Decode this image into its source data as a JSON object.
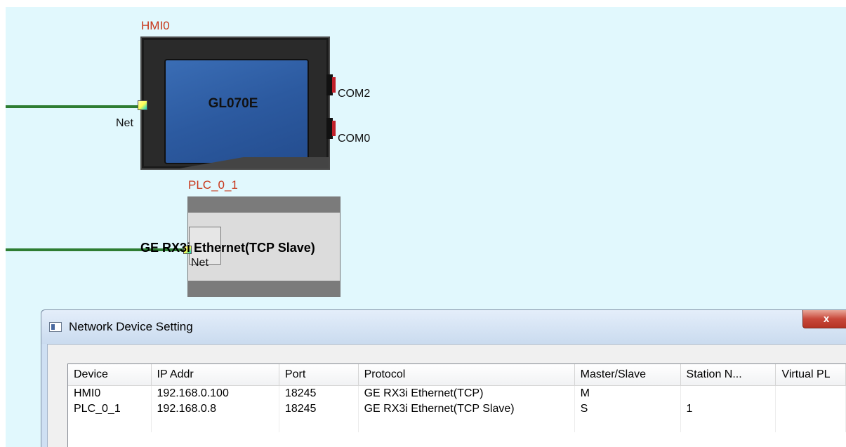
{
  "canvas": {
    "hmi": {
      "name": "HMI0",
      "model": "GL070E",
      "ports": {
        "net": "Net",
        "com2": "COM2",
        "com0": "COM0"
      }
    },
    "plc": {
      "name": "PLC_0_1",
      "title": "GE RX3i Ethernet(TCP Slave)",
      "ports": {
        "net": "Net"
      }
    }
  },
  "dialog": {
    "title": "Network Device Setting",
    "close_label": "x",
    "columns": [
      "Device",
      "IP Addr",
      "Port",
      "Protocol",
      "Master/Slave",
      "Station N...",
      "Virtual PL"
    ],
    "rows": [
      [
        "HMI0",
        "192.168.0.100",
        "18245",
        "GE RX3i Ethernet(TCP)",
        "M",
        "",
        ""
      ],
      [
        "PLC_0_1",
        "192.168.0.8",
        "18245",
        "GE RX3i Ethernet(TCP Slave)",
        "S",
        "1",
        ""
      ]
    ]
  }
}
